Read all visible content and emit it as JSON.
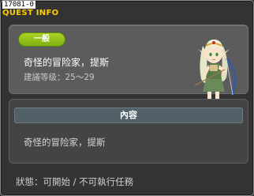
{
  "quest": {
    "id": "17081-0",
    "window_title": "QUEST INFO",
    "category": "一般",
    "name": "奇怪的冒险家，提斯",
    "level_requirement": "建議等级：25～29"
  },
  "content": {
    "header": "內容",
    "text": "奇怪的冒险家，提斯"
  },
  "status": {
    "text": "狀態：可開始 / 不可執行任務"
  },
  "colors": {
    "title": "#ffcc00",
    "badge": "#8cc21a",
    "panel": "#5c5c5c",
    "content_header": "#526068"
  },
  "npc": {
    "icon": "elf-archer-npc-icon"
  }
}
